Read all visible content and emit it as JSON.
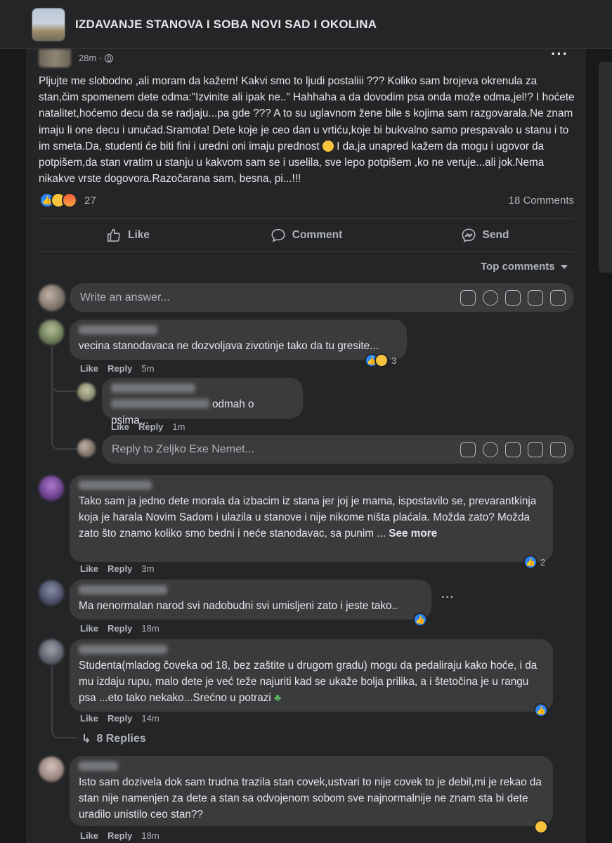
{
  "header": {
    "group_name": "IZDAVANJE STANOVA I SOBA NOVI SAD I OKOLINA"
  },
  "post": {
    "time": "28m ·",
    "text": "Pljujte me slobodno ,ali moram da kažem! Kakvi smo to ljudi postaliii ??? Koliko sam brojeva okrenula za stan,čim spomenem dete odma:\"Izvinite ali ipak ne..\" Hahhaha a da dovodim psa onda može odma,jel!? I hoćete natalitet,hoćemo decu da se radjaju...pa gde ??? A to su uglavnom žene bile s kojima sam razgovarala.Ne znam imaju li one decu i unučad.Sramota! Dete koje je ceo dan u vrtiću,koje bi bukvalno samo prespavalo u stanu i to im smeta.Da, studenti će biti fini i uredni oni imaju prednost",
    "text2": " I da,ja unapred kažem da mogu i ugovor da potpišem,da stan vratim u stanju u kakvom sam se i uselila, sve lepo potpišem ,ko ne veruje...ali jok.Nema nikakve vrste dogovora.Razočarana sam, besna, pi...!!!",
    "reaction_count": "27",
    "comments_count": "18 Comments"
  },
  "actions": {
    "like": "Like",
    "comment": "Comment",
    "send": "Send"
  },
  "sort_label": "Top comments",
  "composer": {
    "placeholder": "Write an answer..."
  },
  "reply_composer": {
    "placeholder": "Reply to Zeljko Exe Nemet..."
  },
  "comment_actions": {
    "like": "Like",
    "reply": "Reply"
  },
  "comments": [
    {
      "text": "vecina stanodavaca ne dozvoljava zivotinje tako da tu gresite...",
      "time": "5m",
      "reactions": "3"
    },
    {
      "text": "odmah o psima...",
      "time": "1m"
    },
    {
      "text": "Tako sam ja jedno dete morala da izbacim iz stana jer joj je mama, ispostavilo se, prevarantkinja koja je harala Novim Sadom i ulazila u stanove i nije nikome ništa plaćala. Možda zato? Možda zato što znamo koliko smo bedni i neće stanodavac, sa punim ...",
      "see_more": "See more",
      "time": "3m",
      "reactions": "2"
    },
    {
      "text": "Ma nenormalan narod svi nadobudni svi umisljeni zato i jeste tako..",
      "time": "18m"
    },
    {
      "text": "Studenta(mladog čoveka od 18, bez zaštite u drugom gradu) mogu da pedaliraju kako hoće, i da mu izdaju rupu, malo dete je već teže najuriti kad se ukaže bolja prilika, a i štetočina je u rangu psa ...eto tako nekako...Srećno u potrazi",
      "time": "14m",
      "replies": "8 Replies"
    },
    {
      "text": "Isto sam dozivela dok sam trudna trazila stan covek,ustvari to nije covek to je debil,mi je rekao da stan nije namenjen za dete a stan sa odvojenom sobom sve najnormalnije ne znam sta bi dete uradilo unistilo ceo stan??",
      "time": "18m"
    }
  ]
}
